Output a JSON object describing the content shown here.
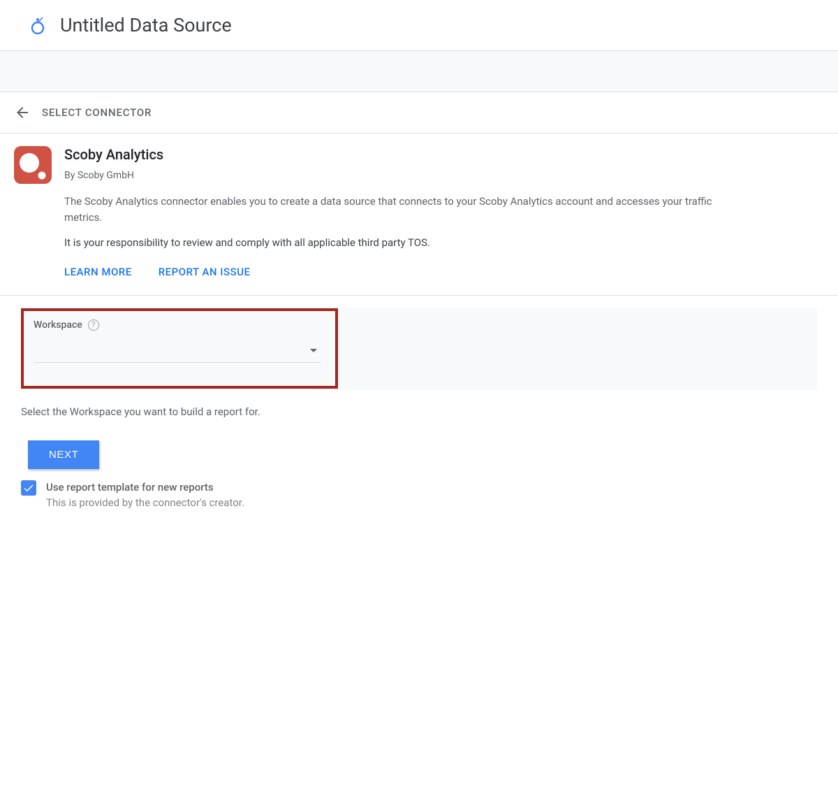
{
  "header": {
    "title": "Untitled Data Source"
  },
  "nav": {
    "select_connector": "SELECT CONNECTOR"
  },
  "connector": {
    "name": "Scoby Analytics",
    "author": "By Scoby GmbH",
    "description": "The Scoby Analytics connector enables you to create a data source that connects to your Scoby Analytics account and accesses your traffic metrics.",
    "tos": "It is your responsibility to review and comply with all applicable third party TOS.",
    "learn_more": "LEARN MORE",
    "report_issue": "REPORT AN ISSUE"
  },
  "workspace": {
    "label": "Workspace",
    "instruction": "Select the Workspace you want to build a report for."
  },
  "next_label": "NEXT",
  "template_checkbox": {
    "label": "Use report template for new reports",
    "sub": "This is provided by the connector's creator."
  },
  "colors": {
    "accent": "#4285f4",
    "highlight_border": "#a02821"
  }
}
